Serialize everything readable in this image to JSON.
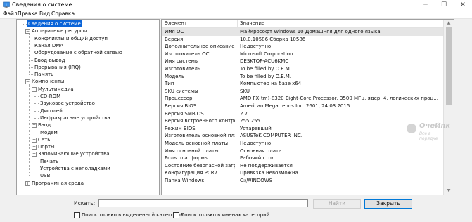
{
  "window": {
    "title": "Сведения о системе"
  },
  "menu": [
    {
      "label": "Файл"
    },
    {
      "label": "Правка"
    },
    {
      "label": "Вид"
    },
    {
      "label": "Справка"
    }
  ],
  "tree": [
    {
      "label": "Сведения о системе",
      "selected": true
    },
    {
      "label": "Аппаратные ресурсы",
      "toggle": "-"
    },
    {
      "label": "Конфликты и общий доступ"
    },
    {
      "label": "Канал DMA"
    },
    {
      "label": "Оборудование с обратной связью"
    },
    {
      "label": "Ввод-вывод"
    },
    {
      "label": "Прерывания (IRQ)"
    },
    {
      "label": "Память"
    },
    {
      "label": "Компоненты",
      "toggle": "-"
    },
    {
      "label": "Мультимедиа",
      "toggle": "+"
    },
    {
      "label": "CD-ROM"
    },
    {
      "label": "Звуковое устройство"
    },
    {
      "label": "Дисплей"
    },
    {
      "label": "Инфракрасные устройства"
    },
    {
      "label": "Ввод",
      "toggle": "+"
    },
    {
      "label": "Модем"
    },
    {
      "label": "Сеть",
      "toggle": "+"
    },
    {
      "label": "Порты",
      "toggle": "+"
    },
    {
      "label": "Запоминающие устройства",
      "toggle": "+"
    },
    {
      "label": "Печать"
    },
    {
      "label": "Устройства с неполадками"
    },
    {
      "label": "USB"
    },
    {
      "label": "Программная среда",
      "toggle": "+"
    }
  ],
  "list": {
    "columns": [
      "Элемент",
      "Значение"
    ],
    "rows": [
      [
        "Имя ОС",
        "Майкрософт Windows 10 Домашняя для одного языка"
      ],
      [
        "Версия",
        "10.0.10586 Сборка 10586"
      ],
      [
        "Дополнительное описание ОС",
        "Недоступно"
      ],
      [
        "Изготовитель ОС",
        "Microsoft Corporation"
      ],
      [
        "Имя системы",
        "DESKTOP-ACU6KMC"
      ],
      [
        "Изготовитель",
        "To be filled by O.E.M."
      ],
      [
        "Модель",
        "To be filled by O.E.M."
      ],
      [
        "Тип",
        "Компьютер на базе x64"
      ],
      [
        "SKU системы",
        "SKU"
      ],
      [
        "Процессор",
        "AMD FX(tm)-8320 Eight-Core Processor, 3500 МГц, ядер: 4, логических проц..."
      ],
      [
        "Версия BIOS",
        "American Megatrends Inc. 2601, 24.03.2015"
      ],
      [
        "Версия SMBIOS",
        "2.7"
      ],
      [
        "Версия встроенного контролл...",
        "255.255"
      ],
      [
        "Режим BIOS",
        "Устаревший"
      ],
      [
        "Изготовитель основной платы",
        "ASUSTeK COMPUTER INC."
      ],
      [
        "Модель основной платы",
        "Недоступно"
      ],
      [
        "Имя основной платы",
        "Основная плата"
      ],
      [
        "Роль платформы",
        "Рабочий стол"
      ],
      [
        "Состояние безопасной загруз...",
        "Не поддерживается"
      ],
      [
        "Конфигурация PCR7",
        "Привязка невозможна"
      ],
      [
        "Папка Windows",
        "C:\\WINDOWS"
      ]
    ]
  },
  "watermark": {
    "brand": "ОчеЙпк",
    "tagline": "Все в порядке"
  },
  "find": {
    "label": "Искать:",
    "value": "",
    "find_button": "Найти",
    "close_button": "Закрыть",
    "option_selected_category": "Поиск только в выделенной категории",
    "option_category_names": "Поиск только в именах категорий"
  }
}
